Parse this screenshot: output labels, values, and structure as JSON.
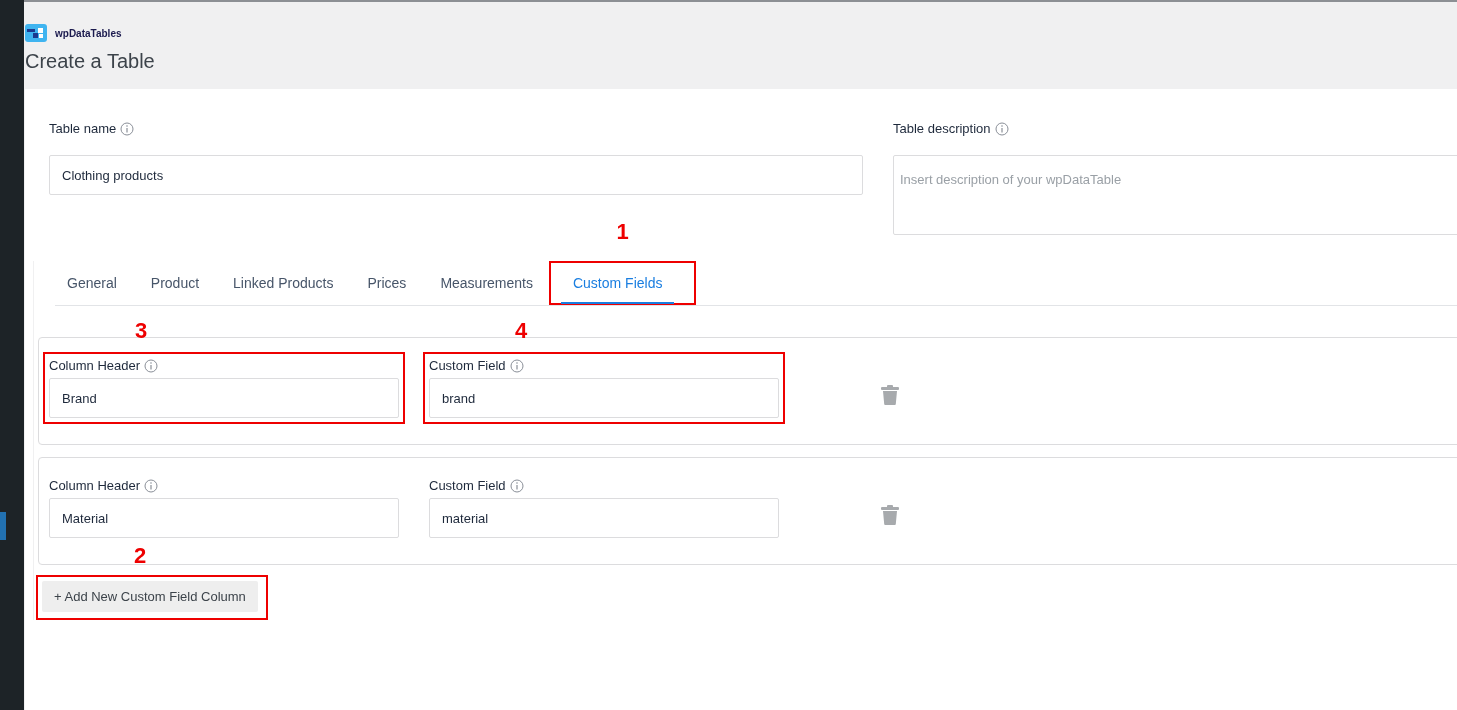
{
  "brand": {
    "name": "wpDataTables"
  },
  "page_title": "Create a Table",
  "table_name": {
    "label": "Table name",
    "value": "Clothing products"
  },
  "table_description": {
    "label": "Table description",
    "placeholder": "Insert description of your wpDataTable"
  },
  "tabs": [
    {
      "label": "General",
      "selected": false
    },
    {
      "label": "Product",
      "selected": false
    },
    {
      "label": "Linked Products",
      "selected": false
    },
    {
      "label": "Prices",
      "selected": false
    },
    {
      "label": "Measurements",
      "selected": false
    },
    {
      "label": "Custom Fields",
      "selected": true,
      "annotation": "1"
    }
  ],
  "custom_field_rows": [
    {
      "column_header": {
        "label": "Column Header",
        "value": "Brand",
        "annotation": "3"
      },
      "custom_field": {
        "label": "Custom Field",
        "value": "brand",
        "annotation": "4"
      }
    },
    {
      "column_header": {
        "label": "Column Header",
        "value": "Material"
      },
      "custom_field": {
        "label": "Custom Field",
        "value": "material"
      }
    }
  ],
  "add_button": {
    "label": "+ Add New Custom Field Column",
    "annotation": "2"
  }
}
